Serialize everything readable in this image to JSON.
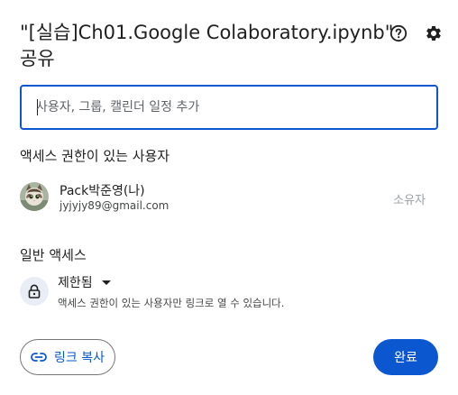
{
  "dialog": {
    "title_line1": "\"[실습]Ch01.Google Colaboratory.ipynb\"",
    "title_line2": "공유",
    "help_icon": "help-circle-icon",
    "settings_icon": "gear-icon"
  },
  "search": {
    "placeholder": "사용자, 그룹, 캘린더 일정 추가",
    "value": ""
  },
  "access_section": {
    "title": "액세스 권한이 있는 사용자",
    "users": [
      {
        "name": "Pack박준영(나)",
        "email": "jyjyjy89@gmail.com",
        "role": "소유자",
        "avatar": "cat-photo-avatar"
      }
    ]
  },
  "general_access": {
    "title": "일반 액세스",
    "icon": "lock-icon",
    "selected": "제한됨",
    "description": "액세스 권한이 있는 사용자만 링크로 열 수 있습니다."
  },
  "footer": {
    "copy_link_label": "링크 복사",
    "copy_link_icon": "link-icon",
    "done_label": "완료"
  },
  "colors": {
    "accent": "#0b57d0",
    "text": "#1f1f1f",
    "muted": "#9aa0a6",
    "lock_bg": "#e9eef6"
  }
}
